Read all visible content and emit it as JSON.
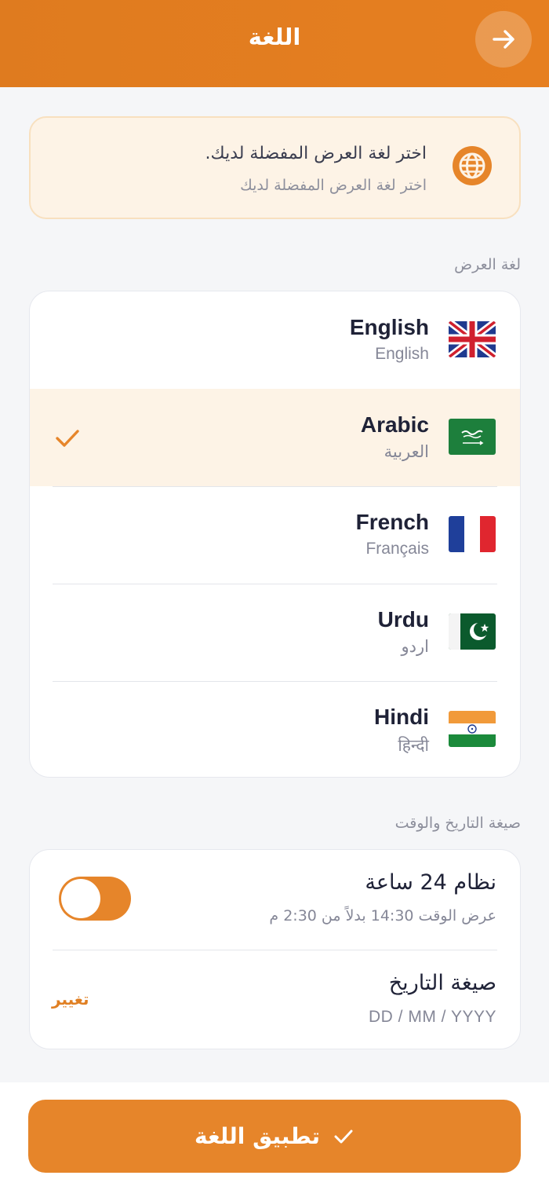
{
  "header": {
    "title": "اللغة",
    "back_icon": "arrow-right-icon"
  },
  "info": {
    "title": "اختر لغة العرض المفضلة لديك.",
    "subtitle": "اختر لغة العرض المفضلة لديك",
    "icon": "globe-icon"
  },
  "display_language": {
    "label": "لغة العرض",
    "selected": "Arabic",
    "languages": [
      {
        "name": "English",
        "native": "English",
        "flag": "uk-flag-icon"
      },
      {
        "name": "Arabic",
        "native": "العربية",
        "flag": "saudi-flag-icon",
        "selected": true
      },
      {
        "name": "French",
        "native": "Français",
        "flag": "france-flag-icon"
      },
      {
        "name": "Urdu",
        "native": "اردو",
        "flag": "pakistan-flag-icon"
      },
      {
        "name": "Hindi",
        "native": "हिन्दी",
        "flag": "india-flag-icon"
      }
    ]
  },
  "datetime": {
    "label": "صيغة التاريخ والوقت",
    "clock24": {
      "title": "نظام 24 ساعة",
      "subtitle": "عرض الوقت 14:30 بدلاً من 2:30 م",
      "enabled": true
    },
    "date_format": {
      "title": "صيغة التاريخ",
      "value": "DD / MM / YYYY",
      "change_label": "تغيير"
    }
  },
  "footer": {
    "apply_label": "تطبيق اللغة",
    "apply_icon": "check-icon"
  },
  "colors": {
    "accent": "#e6852a",
    "header": "#e07d20",
    "selected_row": "#fdf3e6",
    "text_primary": "#1f2237",
    "text_secondary": "#858797"
  }
}
